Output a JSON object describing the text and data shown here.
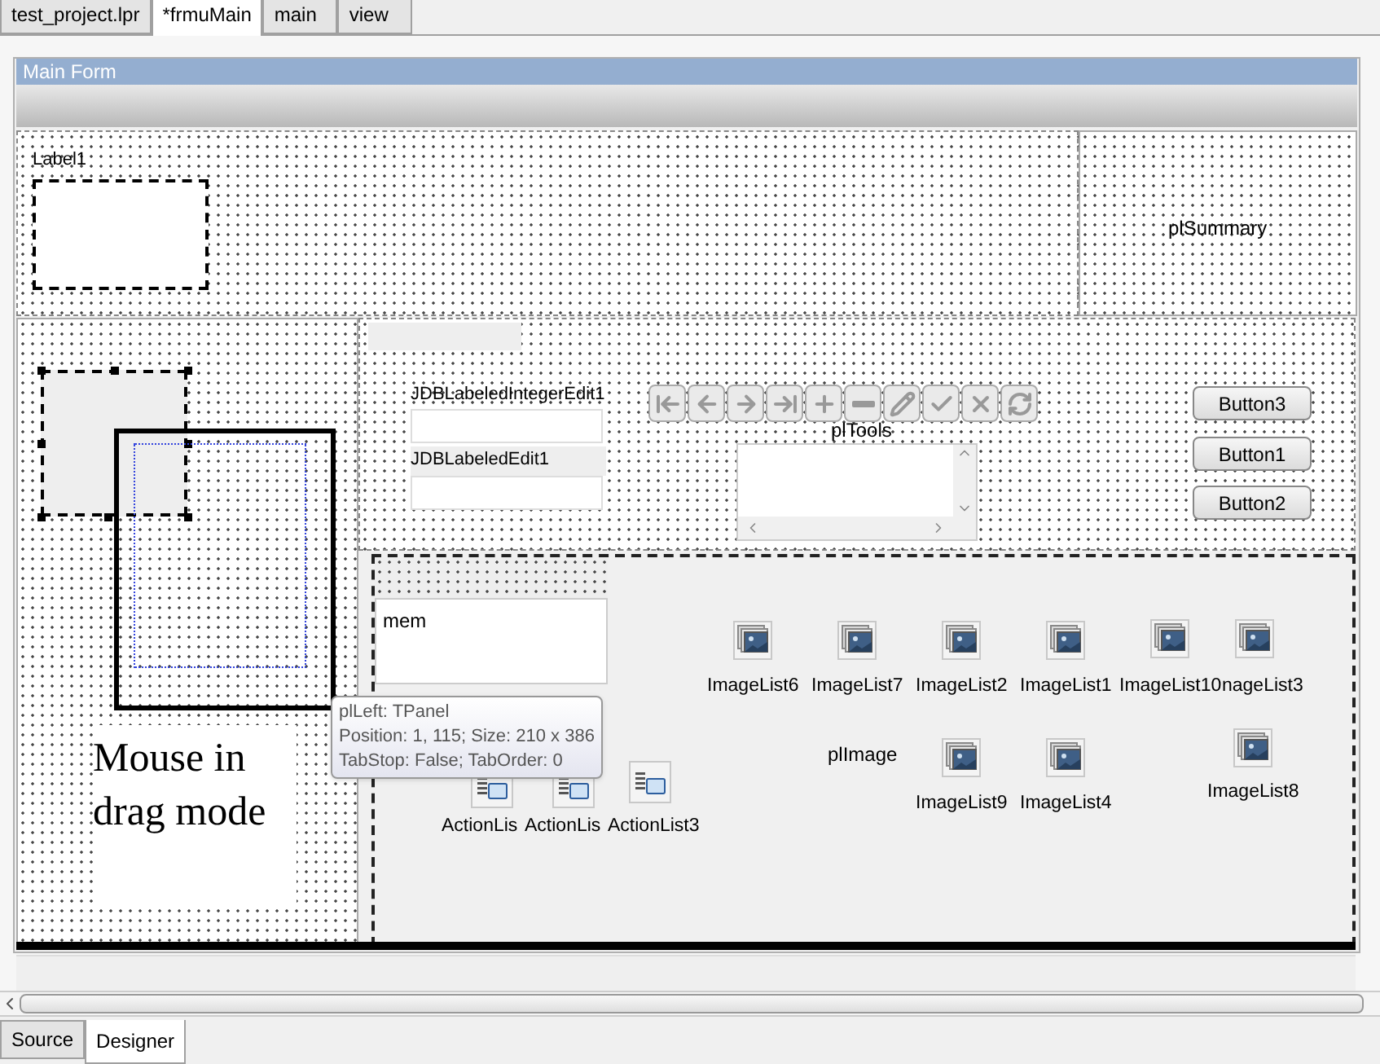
{
  "file_tabs": [
    {
      "label": "test_project.lpr",
      "selected": false
    },
    {
      "label": "*frmuMain",
      "selected": true
    },
    {
      "label": "main",
      "selected": false
    },
    {
      "label": "view",
      "selected": false
    }
  ],
  "form": {
    "title": "Main Form",
    "top_panel": {
      "label": "Label1",
      "summary": "plSummary"
    },
    "tools_panel": {
      "fields": [
        {
          "label": "JDBLabeledIntegerEdit1"
        },
        {
          "label": "JDBLabeledEdit1"
        }
      ],
      "caption": "plTools",
      "buttons": [
        "Button3",
        "Button1",
        "Button2"
      ]
    },
    "drag_note": "Mouse in drag mode",
    "memo": "mem",
    "image_caption": "plImage",
    "components": [
      {
        "name": "ImageList6",
        "kind": "imagelist"
      },
      {
        "name": "ImageList7",
        "kind": "imagelist"
      },
      {
        "name": "ImageList2",
        "kind": "imagelist"
      },
      {
        "name": "ImageList1",
        "kind": "imagelist"
      },
      {
        "name": "ImageList10",
        "kind": "imagelist"
      },
      {
        "name": "nageList3",
        "kind": "imagelist"
      },
      {
        "name": "ImageList9",
        "kind": "imagelist"
      },
      {
        "name": "ImageList4",
        "kind": "imagelist"
      },
      {
        "name": "ImageList8",
        "kind": "imagelist"
      },
      {
        "name": "ActionLis",
        "kind": "actionlist"
      },
      {
        "name": "ActionLis",
        "kind": "actionlist"
      },
      {
        "name": "ActionList3",
        "kind": "actionlist"
      }
    ],
    "tooltip": {
      "lines": [
        "plLeft: TPanel",
        "Position: 1, 115; Size: 210 x 386",
        "TabStop: False; TabOrder: 0"
      ]
    }
  },
  "view_tabs": [
    {
      "label": "Source",
      "selected": false
    },
    {
      "label": "Designer",
      "selected": true
    }
  ]
}
